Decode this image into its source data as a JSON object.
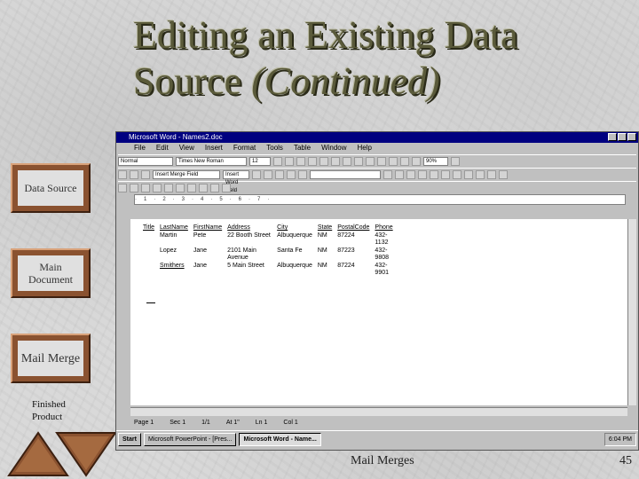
{
  "slide": {
    "title_line1": "Editing an Existing Data",
    "title_line2_plain": "Source ",
    "title_line2_italic": "(Continued)",
    "footer": "Mail Merges",
    "page_number": "45",
    "accent_color": "#8a5230"
  },
  "nav": {
    "data_source": "Data Source",
    "main_document": "Main Document",
    "mail_merge": "Mail Merge",
    "finished_product": "Finished Product"
  },
  "window": {
    "title": "Microsoft Word - Names2.doc",
    "menu": [
      "File",
      "Edit",
      "View",
      "Insert",
      "Format",
      "Tools",
      "Table",
      "Window",
      "Help"
    ],
    "style_combo": "Normal",
    "font_combo": "Times New Roman",
    "size_combo": "12",
    "zoom": "90%",
    "insert_merge_field": "Insert Merge Field",
    "insert_word_field": "Insert Word Field"
  },
  "table": {
    "headers": [
      "Title",
      "LastName",
      "FirstName",
      "Address",
      "City",
      "State",
      "PostalCode",
      "Phone"
    ],
    "rows": [
      [
        "",
        "Martin",
        "Pete",
        "22 Booth Street",
        "Albuquerque",
        "NM",
        "87224",
        "432-1132"
      ],
      [
        "",
        "Lopez",
        "Jane",
        "2101 Main Avenue",
        "Santa Fe",
        "NM",
        "87223",
        "432-9808"
      ],
      [
        "",
        "Smithers",
        "Jane",
        "5 Main Street",
        "Albuquerque",
        "NM",
        "87224",
        "432-9901"
      ]
    ]
  },
  "status": {
    "page": "Page 1",
    "sec": "Sec 1",
    "position": "1/1",
    "at": "At 1\"",
    "ln": "Ln 1",
    "col": "Col 1"
  },
  "taskbar": {
    "start": "Start",
    "powerpoint": "Microsoft PowerPoint - [Pres...",
    "word": "Microsoft Word - Name...",
    "clock": "6:04 PM"
  }
}
